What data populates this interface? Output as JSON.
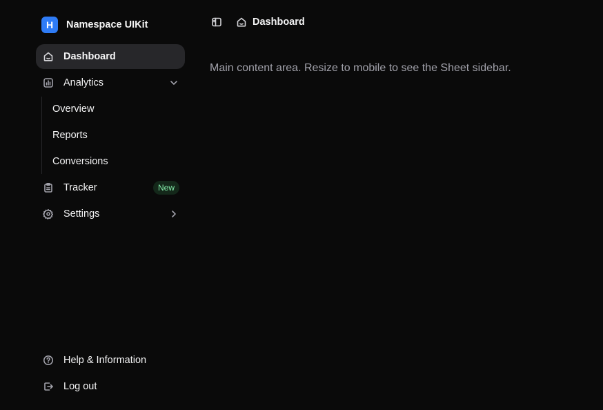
{
  "brand": {
    "logo_letter": "H",
    "name": "Namespace UIKit",
    "logo_color": "#2f7cf6"
  },
  "sidebar": {
    "items": [
      {
        "label": "Dashboard",
        "icon": "home-icon",
        "active": true
      },
      {
        "label": "Analytics",
        "icon": "chart-icon",
        "expanded": true,
        "children": [
          "Overview",
          "Reports",
          "Conversions"
        ]
      },
      {
        "label": "Tracker",
        "icon": "clipboard-icon",
        "badge": "New"
      },
      {
        "label": "Settings",
        "icon": "gear-icon",
        "has_submenu": true
      }
    ],
    "footer": [
      {
        "label": "Help & Information",
        "icon": "help-circle-icon"
      },
      {
        "label": "Log out",
        "icon": "logout-icon"
      }
    ]
  },
  "header": {
    "toggle_icon": "sidebar-toggle-icon",
    "breadcrumb": {
      "icon": "home-icon",
      "label": "Dashboard"
    }
  },
  "main": {
    "text": "Main content area. Resize to mobile to see the Sheet sidebar."
  },
  "colors": {
    "background": "#0a0a0a",
    "active_item": "#27272a",
    "muted_text": "#a1a1aa",
    "badge_bg": "#14281a",
    "badge_text": "#86efac"
  }
}
